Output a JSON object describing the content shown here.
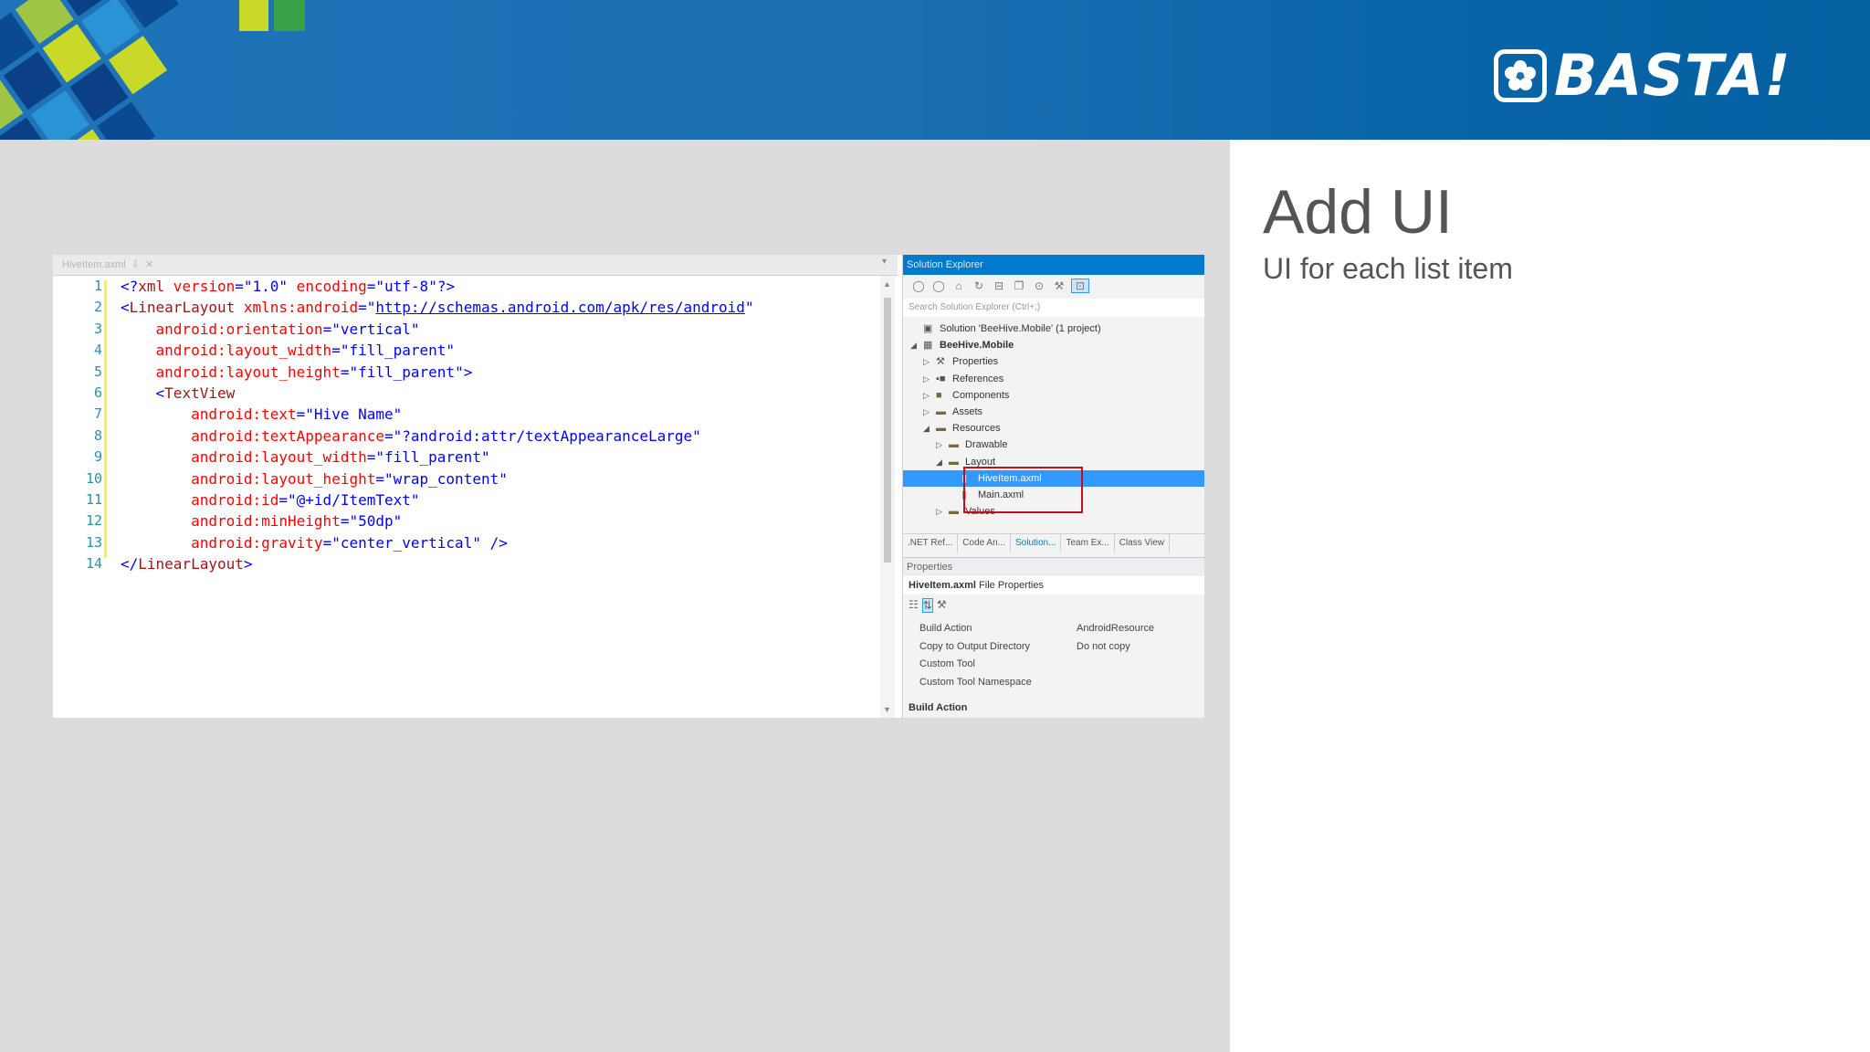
{
  "header": {
    "brand": "BASTA!",
    "brand_icon": "flower-logo-icon"
  },
  "slide": {
    "title": "Add UI",
    "subtitle": "UI for each list item"
  },
  "editor": {
    "tab_label": "HiveItem.axml",
    "tab_pin": "⇩",
    "tab_close": "✕",
    "lines": [
      {
        "n": "1",
        "s": [
          {
            "t": "<?",
            "c": "br"
          },
          {
            "t": "xml",
            "c": "tag"
          },
          {
            "t": " version",
            "c": "attr"
          },
          {
            "t": "=\"",
            "c": "br"
          },
          {
            "t": "1.0",
            "c": "val"
          },
          {
            "t": "\"",
            "c": "br"
          },
          {
            "t": " encoding",
            "c": "attr"
          },
          {
            "t": "=\"",
            "c": "br"
          },
          {
            "t": "utf-8",
            "c": "val"
          },
          {
            "t": "\"?>",
            "c": "br"
          }
        ]
      },
      {
        "n": "2",
        "s": [
          {
            "t": "<",
            "c": "br"
          },
          {
            "t": "LinearLayout",
            "c": "tag"
          },
          {
            "t": " xmlns:android",
            "c": "attr"
          },
          {
            "t": "=\"",
            "c": "br"
          },
          {
            "t": "http://schemas.android.com/apk/res/android",
            "c": "link"
          },
          {
            "t": "\"",
            "c": "br"
          }
        ]
      },
      {
        "n": "3",
        "s": [
          {
            "t": "    android:orientation",
            "c": "attr"
          },
          {
            "t": "=\"",
            "c": "br"
          },
          {
            "t": "vertical",
            "c": "val"
          },
          {
            "t": "\"",
            "c": "br"
          }
        ]
      },
      {
        "n": "4",
        "s": [
          {
            "t": "    android:layout_width",
            "c": "attr"
          },
          {
            "t": "=\"",
            "c": "br"
          },
          {
            "t": "fill_parent",
            "c": "val"
          },
          {
            "t": "\"",
            "c": "br"
          }
        ]
      },
      {
        "n": "5",
        "s": [
          {
            "t": "    android:layout_height",
            "c": "attr"
          },
          {
            "t": "=\"",
            "c": "br"
          },
          {
            "t": "fill_parent",
            "c": "val"
          },
          {
            "t": "\">",
            "c": "br"
          }
        ]
      },
      {
        "n": "6",
        "s": [
          {
            "t": "    <",
            "c": "br"
          },
          {
            "t": "TextView",
            "c": "tag"
          }
        ]
      },
      {
        "n": "7",
        "s": [
          {
            "t": "        android:text",
            "c": "attr"
          },
          {
            "t": "=\"",
            "c": "br"
          },
          {
            "t": "Hive Name",
            "c": "val"
          },
          {
            "t": "\"",
            "c": "br"
          }
        ]
      },
      {
        "n": "8",
        "s": [
          {
            "t": "        android:textAppearance",
            "c": "attr"
          },
          {
            "t": "=\"",
            "c": "br"
          },
          {
            "t": "?android:attr/textAppearanceLarge",
            "c": "val"
          },
          {
            "t": "\"",
            "c": "br"
          }
        ]
      },
      {
        "n": "9",
        "s": [
          {
            "t": "        android:layout_width",
            "c": "attr"
          },
          {
            "t": "=\"",
            "c": "br"
          },
          {
            "t": "fill_parent",
            "c": "val"
          },
          {
            "t": "\"",
            "c": "br"
          }
        ]
      },
      {
        "n": "10",
        "s": [
          {
            "t": "        android:layout_height",
            "c": "attr"
          },
          {
            "t": "=\"",
            "c": "br"
          },
          {
            "t": "wrap_content",
            "c": "val"
          },
          {
            "t": "\"",
            "c": "br"
          }
        ]
      },
      {
        "n": "11",
        "s": [
          {
            "t": "        android:id",
            "c": "attr"
          },
          {
            "t": "=\"",
            "c": "br"
          },
          {
            "t": "@+id/ItemText",
            "c": "val"
          },
          {
            "t": "\"",
            "c": "br"
          }
        ]
      },
      {
        "n": "12",
        "s": [
          {
            "t": "        android:minHeight",
            "c": "attr"
          },
          {
            "t": "=\"",
            "c": "br"
          },
          {
            "t": "50dp",
            "c": "val"
          },
          {
            "t": "\"",
            "c": "br"
          }
        ]
      },
      {
        "n": "13",
        "s": [
          {
            "t": "        android:gravity",
            "c": "attr"
          },
          {
            "t": "=\"",
            "c": "br"
          },
          {
            "t": "center_vertical",
            "c": "val"
          },
          {
            "t": "\" />",
            "c": "br"
          }
        ]
      },
      {
        "n": "14",
        "s": [
          {
            "t": "</",
            "c": "br"
          },
          {
            "t": "LinearLayout",
            "c": "tag"
          },
          {
            "t": ">",
            "c": "br"
          }
        ]
      }
    ]
  },
  "solution_explorer": {
    "title": "Solution Explorer",
    "search_placeholder": "Search Solution Explorer (Ctrl+;)",
    "tree": [
      {
        "label": "Solution 'BeeHive.Mobile' (1 project)",
        "depth": 0,
        "arrow": "",
        "icon": "solution-icon",
        "glyph": "▣"
      },
      {
        "label": "BeeHive.Mobile",
        "depth": 0,
        "arrow": "◢",
        "icon": "project-icon",
        "glyph": "▦",
        "bold": true
      },
      {
        "label": "Properties",
        "depth": 1,
        "arrow": "▷",
        "icon": "wrench-icon",
        "glyph": "⚒"
      },
      {
        "label": "References",
        "depth": 1,
        "arrow": "▷",
        "icon": "references-icon",
        "glyph": "▪■"
      },
      {
        "label": "Components",
        "depth": 1,
        "arrow": "▷",
        "icon": "folder-icon",
        "glyph": "■"
      },
      {
        "label": "Assets",
        "depth": 1,
        "arrow": "▷",
        "icon": "folder-icon",
        "glyph": "▬"
      },
      {
        "label": "Resources",
        "depth": 1,
        "arrow": "◢",
        "icon": "folder-icon",
        "glyph": "▬"
      },
      {
        "label": "Drawable",
        "depth": 2,
        "arrow": "▷",
        "icon": "folder-icon",
        "glyph": "▬"
      },
      {
        "label": "Layout",
        "depth": 2,
        "arrow": "◢",
        "icon": "folder-icon",
        "glyph": "▬"
      },
      {
        "label": "HiveItem.axml",
        "depth": 3,
        "arrow": "",
        "icon": "file-icon",
        "glyph": "▯",
        "selected": true
      },
      {
        "label": "Main.axml",
        "depth": 3,
        "arrow": "",
        "icon": "file-icon",
        "glyph": "▯"
      },
      {
        "label": "Values",
        "depth": 2,
        "arrow": "▷",
        "icon": "folder-icon",
        "glyph": "▬"
      }
    ],
    "bottom_tabs": [
      ".NET Ref...",
      "Code An...",
      "Solution...",
      "Team Ex...",
      "Class View"
    ],
    "active_tab": 2
  },
  "properties": {
    "title": "Properties",
    "file_name": "HiveItem.axml",
    "file_suffix": "File Properties",
    "rows": [
      {
        "key": "Build Action",
        "value": "AndroidResource"
      },
      {
        "key": "Copy to Output Directory",
        "value": "Do not copy"
      },
      {
        "key": "Custom Tool",
        "value": ""
      },
      {
        "key": "Custom Tool Namespace",
        "value": ""
      }
    ],
    "description_title": "Build Action"
  },
  "colors": {
    "banner": "#1f73b8",
    "slide_bg": "#dcdbdd",
    "vs_accent": "#007acc",
    "highlight_box": "#c0101f",
    "title_text": "#555555"
  }
}
